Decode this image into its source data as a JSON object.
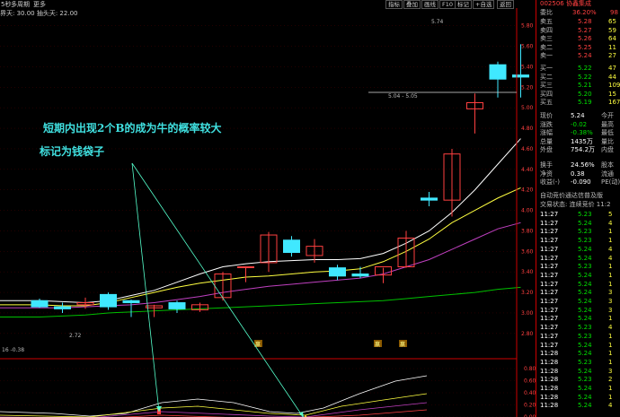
{
  "topbar": {
    "tabs": [
      "5秒",
      "多周期",
      "更多"
    ],
    "buttons": [
      "指标",
      "叠加",
      "画线",
      "F10",
      "标记",
      "+自选",
      "返回"
    ]
  },
  "infobar": {
    "line1": "界天: 30.00  抽头天: 22.00"
  },
  "price_axis": [
    "5.80",
    "5.60",
    "5.40",
    "5.20",
    "5.00",
    "4.80",
    "4.60",
    "4.40",
    "4.20",
    "4.00",
    "3.80",
    "3.60",
    "3.40",
    "3.20",
    "3.00",
    "2.80"
  ],
  "price_annotations": {
    "high": "5.74",
    "gap": "5.04 - 5.05",
    "low": "2.72"
  },
  "indicator": {
    "label": "16 -0.38",
    "axis": [
      "0.80",
      "0.60",
      "0.40",
      "0.20",
      "0.00"
    ],
    "markers": [
      "赢",
      "赢",
      "赢"
    ]
  },
  "annotation": {
    "line1": "短期内出现2个B的成为牛的概率较大",
    "line2": "标记为钱袋子"
  },
  "chart_data": {
    "type": "candlestick",
    "candles": [
      {
        "o": 3.12,
        "h": 3.14,
        "l": 3.05,
        "c": 3.06
      },
      {
        "o": 3.06,
        "h": 3.1,
        "l": 3.0,
        "c": 3.04
      },
      {
        "o": 3.08,
        "h": 3.15,
        "l": 3.04,
        "c": 3.1
      },
      {
        "o": 3.18,
        "h": 3.2,
        "l": 3.03,
        "c": 3.06
      },
      {
        "o": 3.12,
        "h": 3.13,
        "l": 2.96,
        "c": 3.1
      },
      {
        "o": 3.05,
        "h": 3.08,
        "l": 2.96,
        "c": 3.07
      },
      {
        "o": 3.1,
        "h": 3.12,
        "l": 3.0,
        "c": 3.04
      },
      {
        "o": 3.03,
        "h": 3.1,
        "l": 3.01,
        "c": 3.08
      },
      {
        "o": 3.15,
        "h": 3.4,
        "l": 3.12,
        "c": 3.38
      },
      {
        "o": 3.45,
        "h": 3.45,
        "l": 3.3,
        "c": 3.45
      },
      {
        "o": 3.49,
        "h": 3.79,
        "l": 3.4,
        "c": 3.76
      },
      {
        "o": 3.71,
        "h": 3.75,
        "l": 3.55,
        "c": 3.59
      },
      {
        "o": 3.56,
        "h": 3.72,
        "l": 3.49,
        "c": 3.65
      },
      {
        "o": 3.44,
        "h": 3.47,
        "l": 3.32,
        "c": 3.36
      },
      {
        "o": 3.38,
        "h": 3.45,
        "l": 3.34,
        "c": 3.36
      },
      {
        "o": 3.37,
        "h": 3.44,
        "l": 3.29,
        "c": 3.45
      },
      {
        "o": 3.45,
        "h": 3.8,
        "l": 3.44,
        "c": 3.73
      },
      {
        "o": 4.12,
        "h": 4.18,
        "l": 4.04,
        "c": 4.1
      },
      {
        "o": 4.1,
        "h": 4.6,
        "l": 3.94,
        "c": 4.55
      },
      {
        "o": 4.99,
        "h": 5.14,
        "l": 4.75,
        "c": 5.05
      },
      {
        "o": 5.42,
        "h": 5.45,
        "l": 5.1,
        "c": 5.28
      },
      {
        "o": 5.32,
        "h": 5.62,
        "l": 5.1,
        "c": 5.3
      }
    ],
    "ma_series": [
      {
        "color": "#ffffff",
        "values": [
          3.12,
          3.11,
          3.1,
          3.12,
          3.17,
          3.22,
          3.3,
          3.38,
          3.45,
          3.48,
          3.5,
          3.51,
          3.52,
          3.52,
          3.53,
          3.58,
          3.68,
          3.8,
          3.98,
          4.2,
          4.45,
          4.7
        ]
      },
      {
        "color": "#ffff40",
        "values": [
          3.08,
          3.07,
          3.07,
          3.1,
          3.15,
          3.2,
          3.25,
          3.29,
          3.32,
          3.35,
          3.36,
          3.38,
          3.4,
          3.41,
          3.43,
          3.5,
          3.6,
          3.72,
          3.88,
          4.0,
          4.12,
          4.22
        ]
      },
      {
        "color": "#c040c0",
        "values": [
          3.05,
          3.05,
          3.06,
          3.07,
          3.08,
          3.1,
          3.13,
          3.16,
          3.2,
          3.23,
          3.26,
          3.28,
          3.3,
          3.32,
          3.34,
          3.38,
          3.45,
          3.52,
          3.62,
          3.72,
          3.82,
          3.88
        ]
      },
      {
        "color": "#00c000",
        "values": [
          2.96,
          2.97,
          2.98,
          3.0,
          3.01,
          3.02,
          3.03,
          3.04,
          3.05,
          3.06,
          3.07,
          3.08,
          3.09,
          3.1,
          3.11,
          3.12,
          3.14,
          3.16,
          3.18,
          3.2,
          3.23,
          3.25
        ]
      }
    ],
    "ylim": [
      2.72,
      5.92
    ]
  },
  "panel": {
    "title": "002506 协鑫集成",
    "wb_label": "委比",
    "wb": "36.20%",
    "wc": "98",
    "asks": [
      {
        "l": "卖五",
        "p": "5.28",
        "v": "65"
      },
      {
        "l": "卖四",
        "p": "5.27",
        "v": "59"
      },
      {
        "l": "卖三",
        "p": "5.26",
        "v": "64"
      },
      {
        "l": "卖二",
        "p": "5.25",
        "v": "11"
      },
      {
        "l": "卖一",
        "p": "5.24",
        "v": "27"
      }
    ],
    "bids": [
      {
        "l": "买一",
        "p": "5.22",
        "v": "47"
      },
      {
        "l": "买二",
        "p": "5.22",
        "v": "44"
      },
      {
        "l": "买三",
        "p": "5.21",
        "v": "109"
      },
      {
        "l": "买四",
        "p": "5.20",
        "v": "15"
      },
      {
        "l": "买五",
        "p": "5.19",
        "v": "167"
      }
    ],
    "stats": [
      {
        "a": "现价",
        "b": "5.24",
        "c": "今开"
      },
      {
        "a": "涨跌",
        "b": "-0.02",
        "c": "最高"
      },
      {
        "a": "涨幅",
        "b": "-0.38%",
        "c": "最低"
      },
      {
        "a": "总量",
        "b": "1435万",
        "c": "量比"
      },
      {
        "a": "外盘",
        "b": "754.2万",
        "c": "内盘"
      }
    ],
    "stats2": [
      {
        "a": "换手",
        "b": "24.56%",
        "c": "股本"
      },
      {
        "a": "净资",
        "b": "0.38",
        "c": "流通"
      },
      {
        "a": "收益(-)",
        "b": "-0.090",
        "c": "PE(动)"
      }
    ],
    "auction": "自动竞价通达信普及版",
    "state": "交易状态: 连续竞价 11:2",
    "ticks": [
      {
        "t": "11:27",
        "p": "5.23",
        "v": "5"
      },
      {
        "t": "11:27",
        "p": "5.24",
        "v": "4"
      },
      {
        "t": "11:27",
        "p": "5.23",
        "v": "1"
      },
      {
        "t": "11:27",
        "p": "5.23",
        "v": "1"
      },
      {
        "t": "11:27",
        "p": "5.24",
        "v": "4"
      },
      {
        "t": "11:27",
        "p": "5.24",
        "v": "4"
      },
      {
        "t": "11:27",
        "p": "5.23",
        "v": "1"
      },
      {
        "t": "11:27",
        "p": "5.24",
        "v": "1"
      },
      {
        "t": "11:27",
        "p": "5.24",
        "v": "1"
      },
      {
        "t": "11:27",
        "p": "5.24",
        "v": "3"
      },
      {
        "t": "11:27",
        "p": "5.24",
        "v": "3"
      },
      {
        "t": "11:27",
        "p": "5.24",
        "v": "3"
      },
      {
        "t": "11:27",
        "p": "5.24",
        "v": "1"
      },
      {
        "t": "11:27",
        "p": "5.23",
        "v": "4"
      },
      {
        "t": "11:27",
        "p": "5.23",
        "v": "1"
      },
      {
        "t": "11:27",
        "p": "5.24",
        "v": "1"
      },
      {
        "t": "11:28",
        "p": "5.24",
        "v": "1"
      },
      {
        "t": "11:28",
        "p": "5.23",
        "v": "1"
      },
      {
        "t": "11:28",
        "p": "5.24",
        "v": "3"
      },
      {
        "t": "11:28",
        "p": "5.23",
        "v": "2"
      },
      {
        "t": "11:28",
        "p": "5.24",
        "v": "1"
      },
      {
        "t": "11:28",
        "p": "5.24",
        "v": "1"
      },
      {
        "t": "11:28",
        "p": "5.24",
        "v": "4"
      }
    ]
  }
}
